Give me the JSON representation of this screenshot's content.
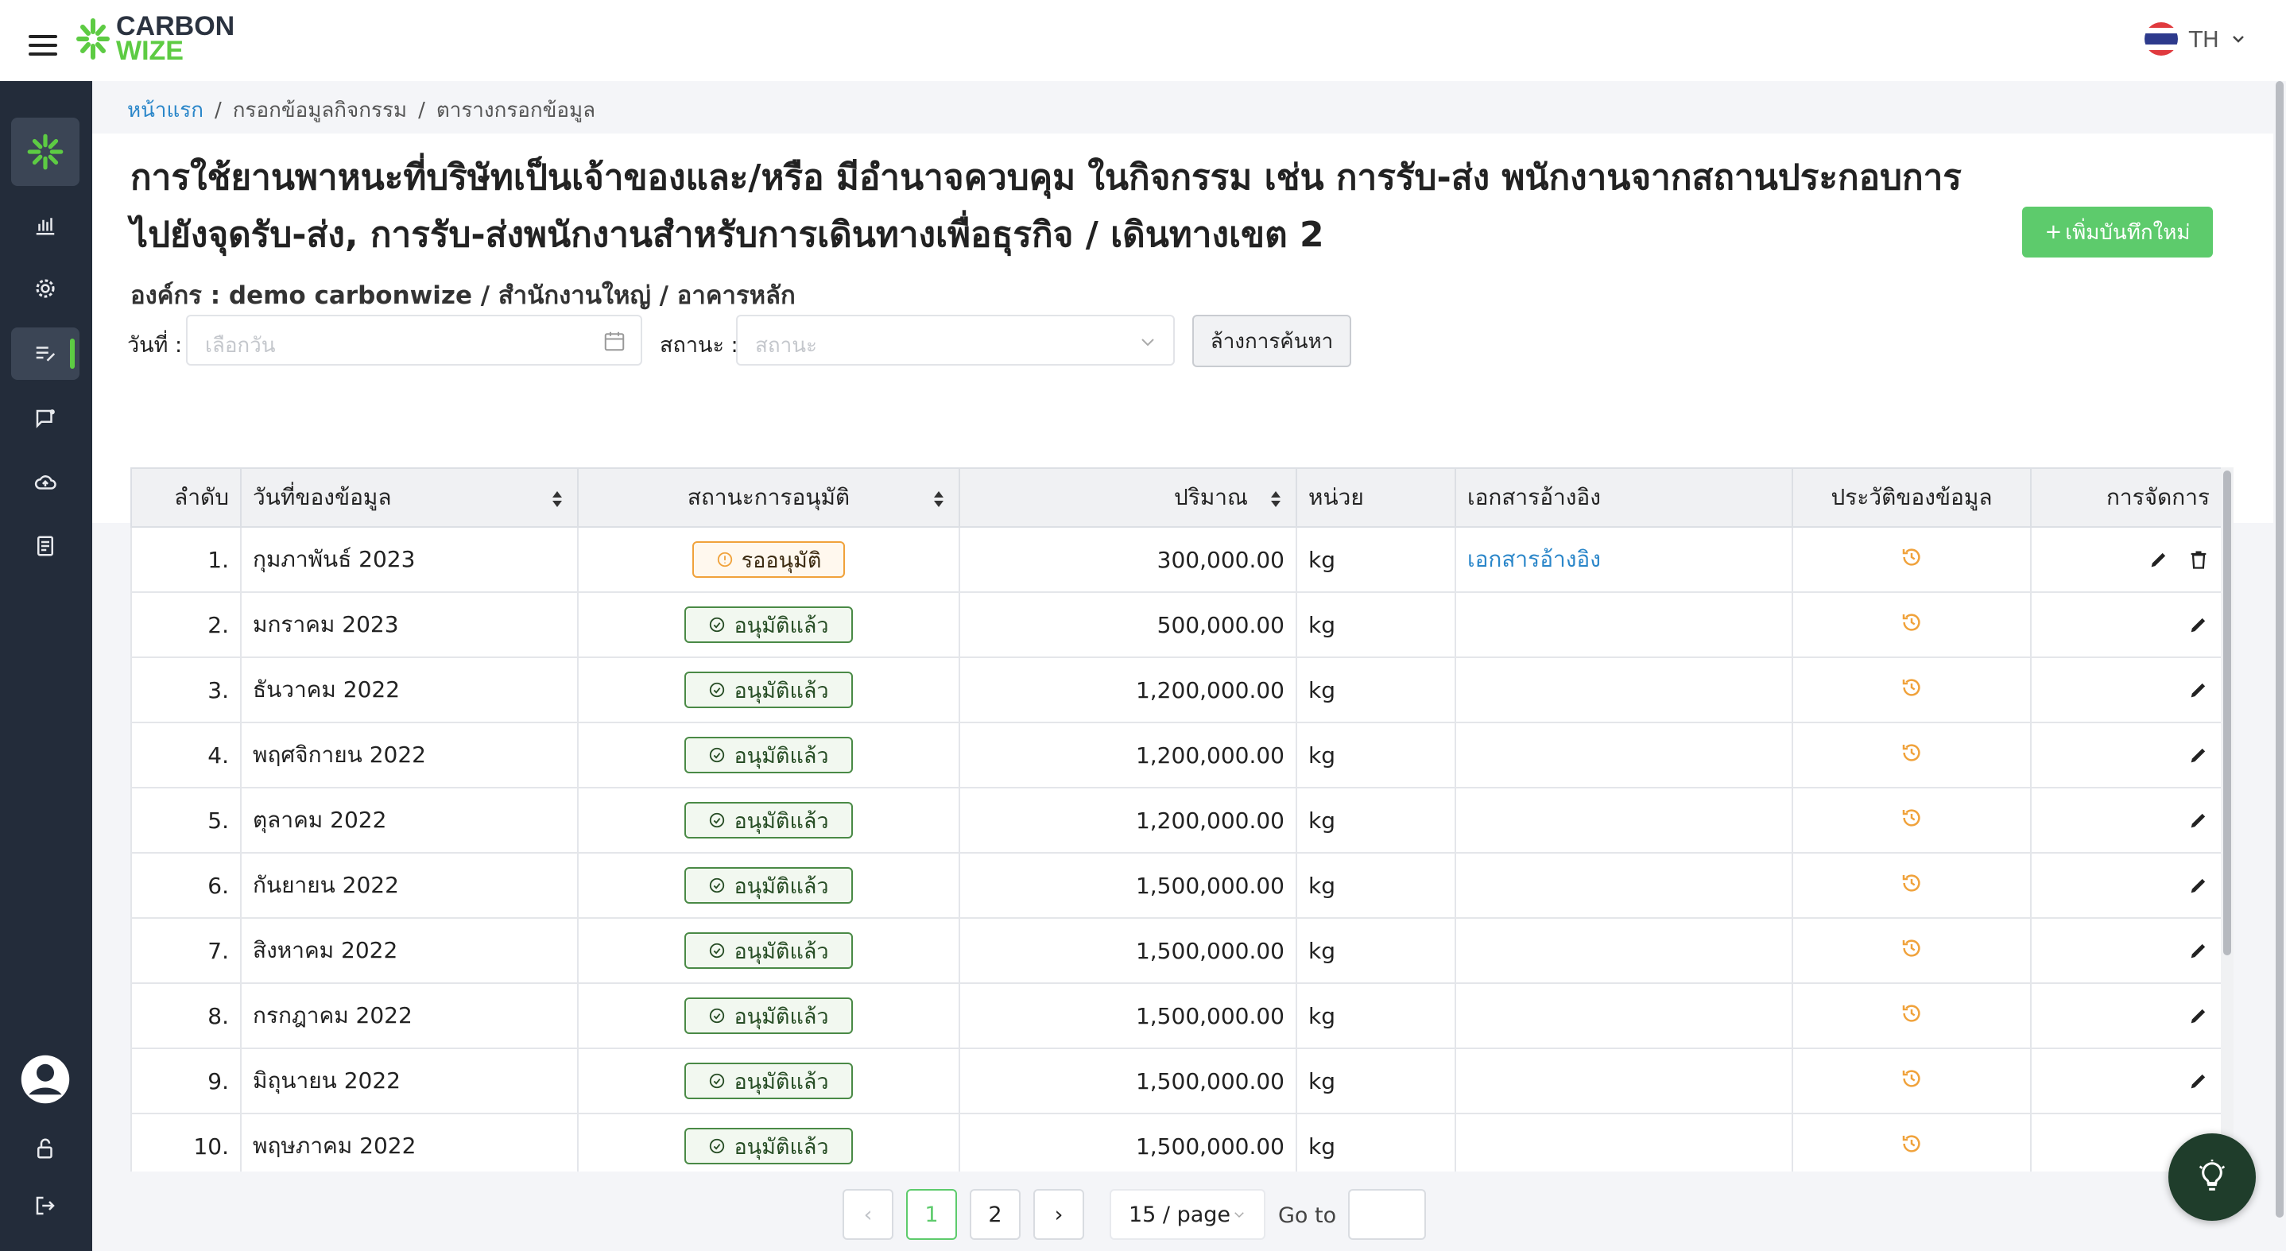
{
  "app": {
    "logo_line1": "CARBON",
    "logo_line2": "WIZE",
    "brand_color": "#5dcb43",
    "sidebar_color": "#232c3a"
  },
  "language": {
    "code": "TH"
  },
  "breadcrumb": [
    {
      "label": "หน้าแรก"
    },
    {
      "label": "กรอกข้อมูลกิจกรรม"
    },
    {
      "label": "ตารางกรอกข้อมูล"
    }
  ],
  "page": {
    "title_line1": "การใช้ยานพาหนะที่บริษัทเป็นเจ้าของและ/หรือ มีอำนาจควบคุม ในกิจกรรม เช่น การรับ-ส่ง พนักงานจากสถานประกอบการ",
    "title_line2": "ไปยังจุดรับ-ส่ง, การรับ-ส่งพนักงานสำหรับการเดินทางเพื่อธุรกิจ / เดินทางเขต 2",
    "org": "องค์กร : demo carbonwize / สำนักงานใหญ่ / อาคารหลัก",
    "add_button": "เพิ่มบันทึกใหม่"
  },
  "filters": {
    "date_label": "วันที่ :",
    "date_placeholder": "เลือกวัน",
    "status_label": "สถานะ :",
    "status_placeholder": "สถานะ",
    "clear_button": "ล้างการค้นหา"
  },
  "table": {
    "columns": [
      "ลำดับ",
      "วันที่ของข้อมูล",
      "สถานะการอนุมัติ",
      "ปริมาณ",
      "หน่วย",
      "เอกสารอ้างอิง",
      "ประวัติของข้อมูล",
      "การจัดการ"
    ],
    "rows": [
      {
        "index": "1.",
        "date": "กุมภาพันธ์ 2023",
        "status": "รออนุมัติ",
        "status_type": "pending",
        "amount": "300,000.00",
        "unit": "kg",
        "reference": "เอกสารอ้างอิง",
        "can_delete": true
      },
      {
        "index": "2.",
        "date": "มกราคม 2023",
        "status": "อนุมัติแล้ว",
        "status_type": "approved",
        "amount": "500,000.00",
        "unit": "kg",
        "reference": "",
        "can_delete": false
      },
      {
        "index": "3.",
        "date": "ธันวาคม 2022",
        "status": "อนุมัติแล้ว",
        "status_type": "approved",
        "amount": "1,200,000.00",
        "unit": "kg",
        "reference": "",
        "can_delete": false
      },
      {
        "index": "4.",
        "date": "พฤศจิกายน 2022",
        "status": "อนุมัติแล้ว",
        "status_type": "approved",
        "amount": "1,200,000.00",
        "unit": "kg",
        "reference": "",
        "can_delete": false
      },
      {
        "index": "5.",
        "date": "ตุลาคม 2022",
        "status": "อนุมัติแล้ว",
        "status_type": "approved",
        "amount": "1,200,000.00",
        "unit": "kg",
        "reference": "",
        "can_delete": false
      },
      {
        "index": "6.",
        "date": "กันยายน 2022",
        "status": "อนุมัติแล้ว",
        "status_type": "approved",
        "amount": "1,500,000.00",
        "unit": "kg",
        "reference": "",
        "can_delete": false
      },
      {
        "index": "7.",
        "date": "สิงหาคม 2022",
        "status": "อนุมัติแล้ว",
        "status_type": "approved",
        "amount": "1,500,000.00",
        "unit": "kg",
        "reference": "",
        "can_delete": false
      },
      {
        "index": "8.",
        "date": "กรกฎาคม 2022",
        "status": "อนุมัติแล้ว",
        "status_type": "approved",
        "amount": "1,500,000.00",
        "unit": "kg",
        "reference": "",
        "can_delete": false
      },
      {
        "index": "9.",
        "date": "มิถุนายน 2022",
        "status": "อนุมัติแล้ว",
        "status_type": "approved",
        "amount": "1,500,000.00",
        "unit": "kg",
        "reference": "",
        "can_delete": false
      },
      {
        "index": "10.",
        "date": "พฤษภาคม 2022",
        "status": "อนุมัติแล้ว",
        "status_type": "approved",
        "amount": "1,500,000.00",
        "unit": "kg",
        "reference": "",
        "can_delete": false
      }
    ]
  },
  "pagination": {
    "pages": [
      "1",
      "2"
    ],
    "current": "1",
    "page_size": "15 / page",
    "goto_label": "Go to",
    "goto_value": ""
  },
  "colors": {
    "approved": "#4a8a46",
    "pending": "#f0a23b",
    "history_icon": "#f0a23b",
    "link": "#2a86c9"
  },
  "icons": {
    "sidebar": [
      "logo-icon",
      "chart-icon",
      "gear-icon",
      "edit-list-icon",
      "chat-icon",
      "cloud-icon",
      "document-icon",
      "user-icon",
      "unlock-icon",
      "logout-icon"
    ],
    "row_actions": [
      "history-icon",
      "edit-icon",
      "trash-icon"
    ],
    "fab": "lightbulb-icon"
  }
}
